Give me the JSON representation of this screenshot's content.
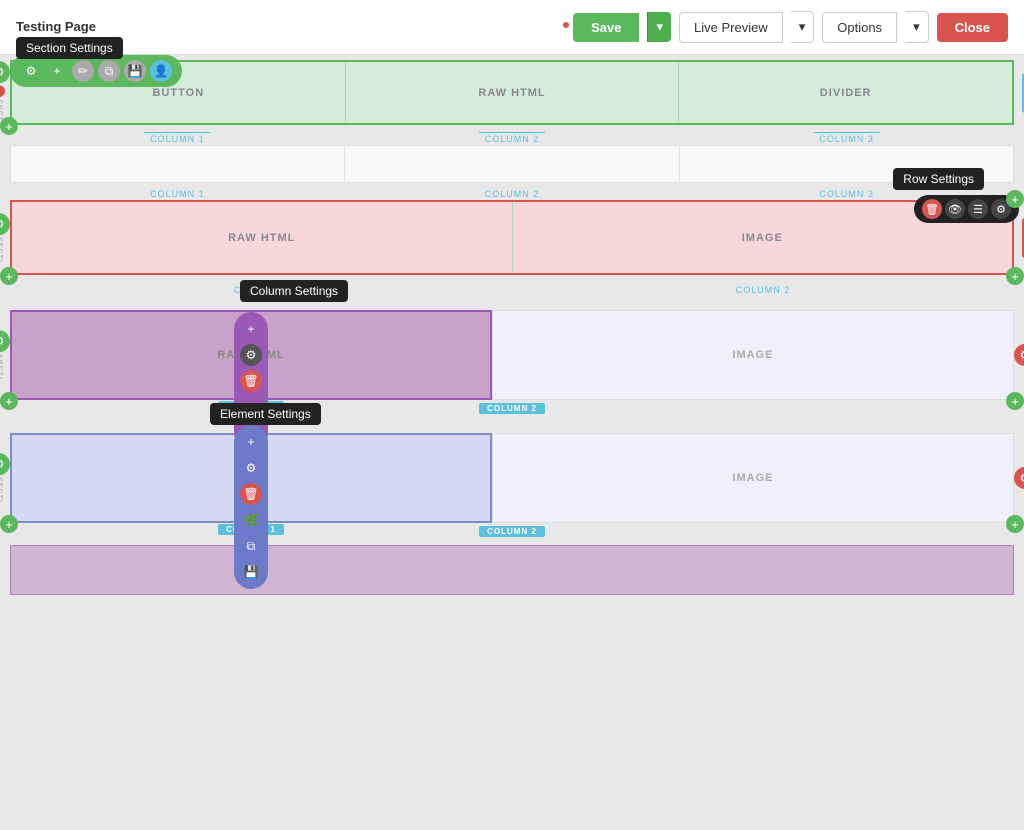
{
  "header": {
    "page_title": "Testing Page",
    "section_settings_label": "Section Settings",
    "save_label": "Save",
    "live_preview_label": "Live Preview",
    "options_label": "Options",
    "close_label": "Close"
  },
  "toolbar": {
    "buttons": [
      "gear",
      "plus",
      "pencil",
      "copy",
      "save",
      "user"
    ]
  },
  "section1": {
    "columns": [
      "BUTTON",
      "RAW HTML",
      "DIVIDER"
    ],
    "col_labels": [
      "COLUMN 1",
      "COLUMN 2",
      "COLUMN 3"
    ]
  },
  "section2": {
    "col_labels": [
      "COLUMN 1",
      "COLUMN 2",
      "COLUMN 3"
    ]
  },
  "section3": {
    "row_settings_label": "Row Settings",
    "columns": [
      "RAW HTML",
      "IMAGE"
    ],
    "col_labels": [
      "COLUMN 1",
      "COLUMN 2"
    ]
  },
  "section4": {
    "col_settings_label": "Column Settings",
    "columns": [
      "RAW HTML",
      "IMAGE"
    ],
    "col_labels": [
      "COLUMN 1",
      "COLUMN 2"
    ]
  },
  "section5": {
    "elem_settings_label": "Element Settings",
    "columns": [
      "",
      "IMAGE"
    ],
    "col_labels": [
      "COLUMN 1",
      "COLUMN 2"
    ]
  },
  "section6": {},
  "labels": {
    "sect": "SECTI...",
    "row": "ROW",
    "image": "IMAGE",
    "raw_html": "RAW HTML",
    "button": "BUTTON",
    "divider": "DIVIDER"
  }
}
